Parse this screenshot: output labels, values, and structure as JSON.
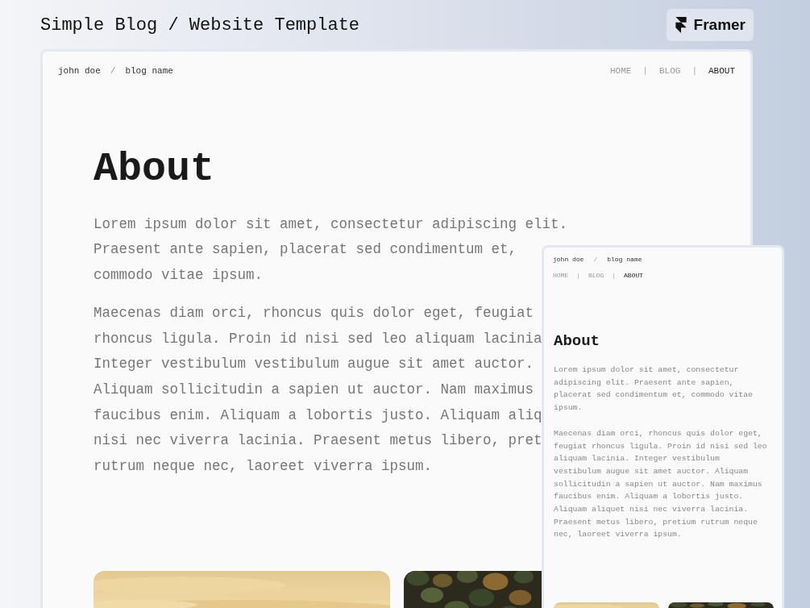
{
  "page_title": "Simple Blog / Website Template",
  "brand": {
    "label": "Framer"
  },
  "desktop": {
    "breadcrumb": [
      {
        "kind": "link",
        "label": "john doe"
      },
      {
        "kind": "separator",
        "label": "/"
      },
      {
        "kind": "link",
        "label": "blog name"
      }
    ],
    "nav": [
      {
        "kind": "link",
        "label": "HOME",
        "selected": false
      },
      {
        "kind": "separator",
        "label": "|"
      },
      {
        "kind": "link",
        "label": "BLOG",
        "selected": false
      },
      {
        "kind": "separator",
        "label": "|"
      },
      {
        "kind": "link",
        "label": "ABOUT",
        "selected": true
      }
    ],
    "heading": "About",
    "paragraphs": [
      [
        "Lorem ipsum dolor sit amet, consectetur adipiscing elit.",
        "Praesent ante sapien, placerat sed condimentum et,",
        "commodo vitae ipsum."
      ],
      [
        "Maecenas diam orci, rhoncus quis dolor eget, feugiat",
        "rhoncus ligula. Proin id nisi sed leo aliquam lacinia",
        "Integer vestibulum vestibulum augue sit amet auctor.",
        "Aliquam sollicitudin a sapien ut auctor. Nam maximus",
        "faucibus enim. Aliquam a lobortis justo. Aliquam aliq",
        "nisi nec viverra lacinia. Praesent metus libero, pret",
        "rutrum neque nec, laoreet viverra ipsum."
      ]
    ],
    "images": [
      {
        "kind": "picture"
      },
      {
        "kind": "picture"
      }
    ]
  },
  "mobile": {
    "breadcrumb": [
      {
        "kind": "link",
        "label": "john doe"
      },
      {
        "kind": "separator",
        "label": "/"
      },
      {
        "kind": "link",
        "label": "blog name"
      }
    ],
    "nav": [
      {
        "kind": "link",
        "label": "HOME",
        "selected": false
      },
      {
        "kind": "separator",
        "label": "|"
      },
      {
        "kind": "link",
        "label": "BLOG",
        "selected": false
      },
      {
        "kind": "separator",
        "label": "|"
      },
      {
        "kind": "link",
        "label": "ABOUT",
        "selected": true
      }
    ],
    "heading": "About",
    "paragraphs": [
      "Lorem ipsum dolor sit amet, consectetur adipiscing elit. Praesent ante sapien, placerat sed condimentum et, commodo vitae ipsum.",
      "Maecenas diam orci, rhoncus quis dolor eget, feugiat rhoncus ligula. Proin id nisi sed leo aliquam lacinia. Integer vestibulum vestibulum augue sit amet auctor. Aliquam sollicitudin a sapien ut auctor. Nam maximus faucibus enim. Aliquam a lobortis justo. Aliquam aliquet nisi nec viverra lacinia. Praesent metus libero, pretium rutrum neque nec, laoreet viverra ipsum."
    ],
    "images": [
      {
        "kind": "picture"
      },
      {
        "kind": "picture"
      }
    ]
  }
}
